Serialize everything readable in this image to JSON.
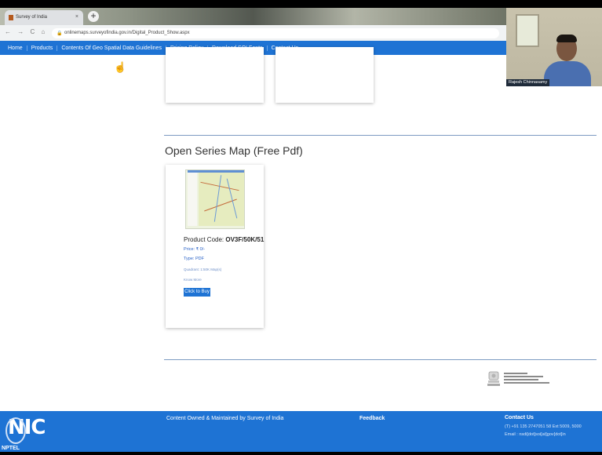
{
  "browser": {
    "tab_title": "Survey of India",
    "tab_close": "×",
    "new_tab": "+",
    "nav_icons": "← → C ⌂",
    "url": "onlinemaps.surveyofindia.gov.in/Digital_Product_Show.aspx"
  },
  "nav": {
    "items": [
      "Home",
      "Products",
      "Contents Of Geo Spatial Data Guidelines",
      "Pricing Policy",
      "Download SOI Fonts",
      "Contact Us"
    ]
  },
  "webcam": {
    "name": "Rajesh Chinnasamy"
  },
  "section": {
    "title": "Open Series Map (Free Pdf)"
  },
  "product": {
    "code_label": "Product Code:",
    "code_value": "OV3F/50K/51",
    "price": "Price: ₹ 0/-",
    "type": "Type: PDF",
    "desc": "Quadrant: 1:50K Map(s)",
    "more": "Know More",
    "buy_label": "Click to Buy"
  },
  "footer": {
    "logo": "NIC",
    "watermark": "NPTEL",
    "owned": "Content Owned & Maintained by Survey of India",
    "feedback": "Feedback",
    "contact_title": "Contact Us",
    "contact_phone": "(T) +91 135 2747051 58 Ext 5009, 5000",
    "contact_email": "Email : nsdi[dot]soi[at]gov[dot]in"
  },
  "colors": {
    "accent": "#1e73d4",
    "rule": "#7d9bc2"
  }
}
